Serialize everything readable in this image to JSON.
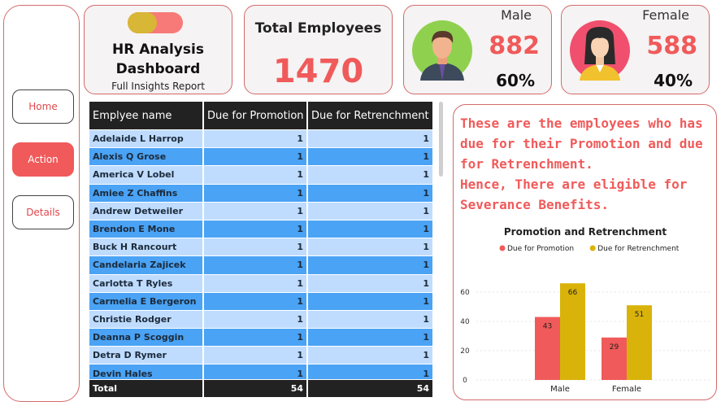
{
  "nav": {
    "home": "Home",
    "action": "Action",
    "details": "Details"
  },
  "header": {
    "title_line1": "HR Analysis",
    "title_line2": "Dashboard",
    "subtitle": "Full Insights Report",
    "total_label": "Total Employees",
    "total_value": "1470"
  },
  "male": {
    "label": "Male",
    "count": "882",
    "pct": "60%"
  },
  "female": {
    "label": "Female",
    "count": "588",
    "pct": "40%"
  },
  "table": {
    "headers": [
      "Emplyee name",
      "Due for Promotion",
      "Due for Retrenchment"
    ],
    "rows": [
      [
        "Adelaide L Harrop",
        "1",
        "1"
      ],
      [
        "Alexis Q Grose",
        "1",
        "1"
      ],
      [
        "America V Lobel",
        "1",
        "1"
      ],
      [
        "Amiee Z Chaffins",
        "1",
        "1"
      ],
      [
        "Andrew Detweiler",
        "1",
        "1"
      ],
      [
        "Brendon E Mone",
        "1",
        "1"
      ],
      [
        "Buck H Rancourt",
        "1",
        "1"
      ],
      [
        "Candelaria Zajicek",
        "1",
        "1"
      ],
      [
        "Carlotta T Ryles",
        "1",
        "1"
      ],
      [
        "Carmelia E Bergeron",
        "1",
        "1"
      ],
      [
        "Christie Rodger",
        "1",
        "1"
      ],
      [
        "Deanna P Scoggin",
        "1",
        "1"
      ],
      [
        "Detra D Rymer",
        "1",
        "1"
      ],
      [
        "Devin Hales",
        "1",
        "1"
      ]
    ],
    "footer": [
      "Total",
      "54",
      "54"
    ]
  },
  "panel": {
    "message": "These are the employees who has due for their Promotion and due for Retrenchment.\nHence, There are eligible for Severance Benefits."
  },
  "chart_data": {
    "type": "bar",
    "title": "Promotion and Retrenchment",
    "categories": [
      "Male",
      "Female"
    ],
    "series": [
      {
        "name": "Due for Promotion",
        "values": [
          43,
          29
        ],
        "color": "#f05a5a"
      },
      {
        "name": "Due for Retrenchment",
        "values": [
          66,
          51
        ],
        "color": "#d9b30a"
      }
    ],
    "ylim": [
      0,
      70
    ],
    "yticks": [
      0,
      20,
      40,
      60
    ],
    "legend": "top",
    "grid": true
  }
}
